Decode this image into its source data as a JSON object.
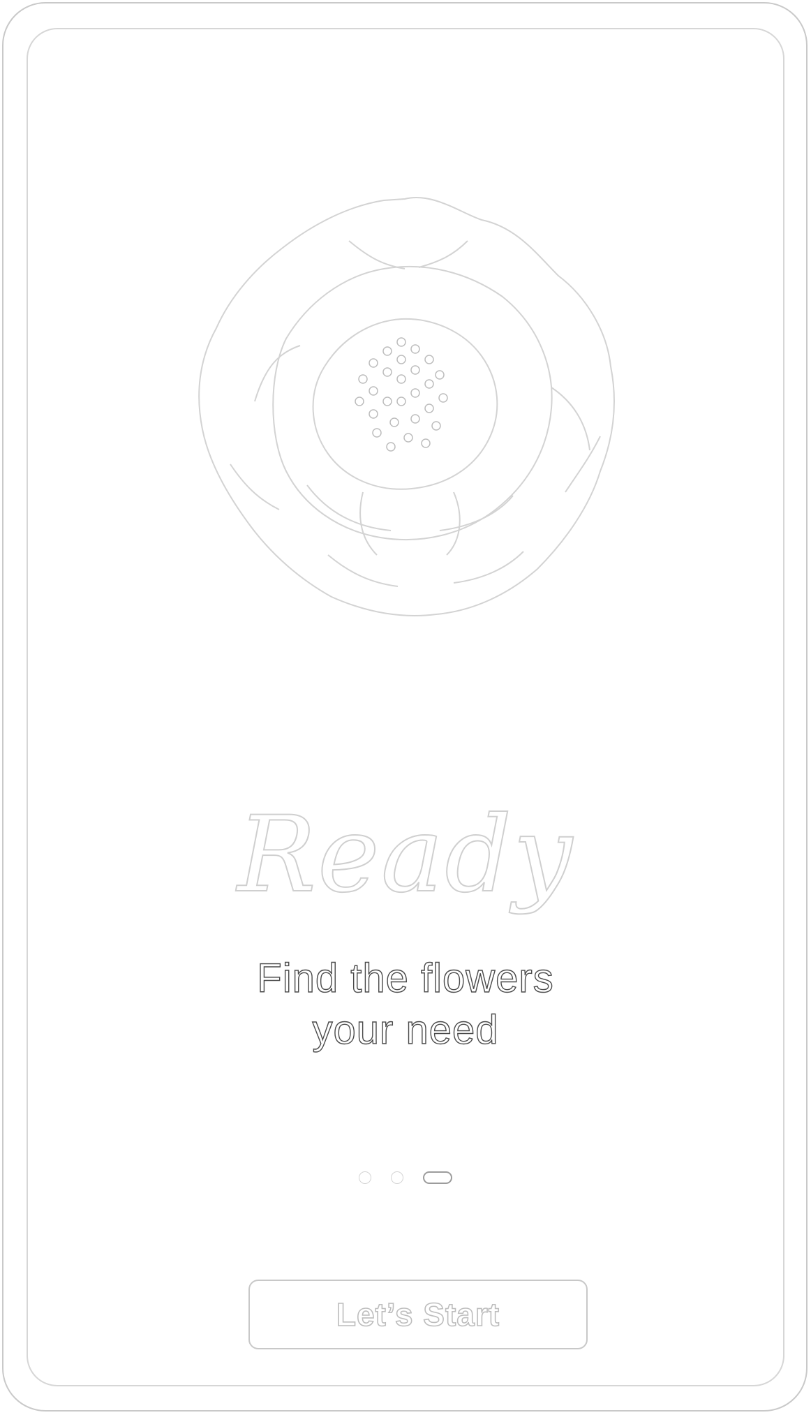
{
  "onboarding": {
    "title": "Ready",
    "subtitle_line1": "Find the flowers",
    "subtitle_line2": "your need",
    "page_count": 3,
    "active_page": 3,
    "start_button_label": "Let’s Start"
  },
  "colors": {
    "background": "#ffffff",
    "outline_light": "#cfcfcf",
    "subtitle_text": "#4a4a4a"
  },
  "icons": {
    "hero_image": "flower-illustration"
  }
}
